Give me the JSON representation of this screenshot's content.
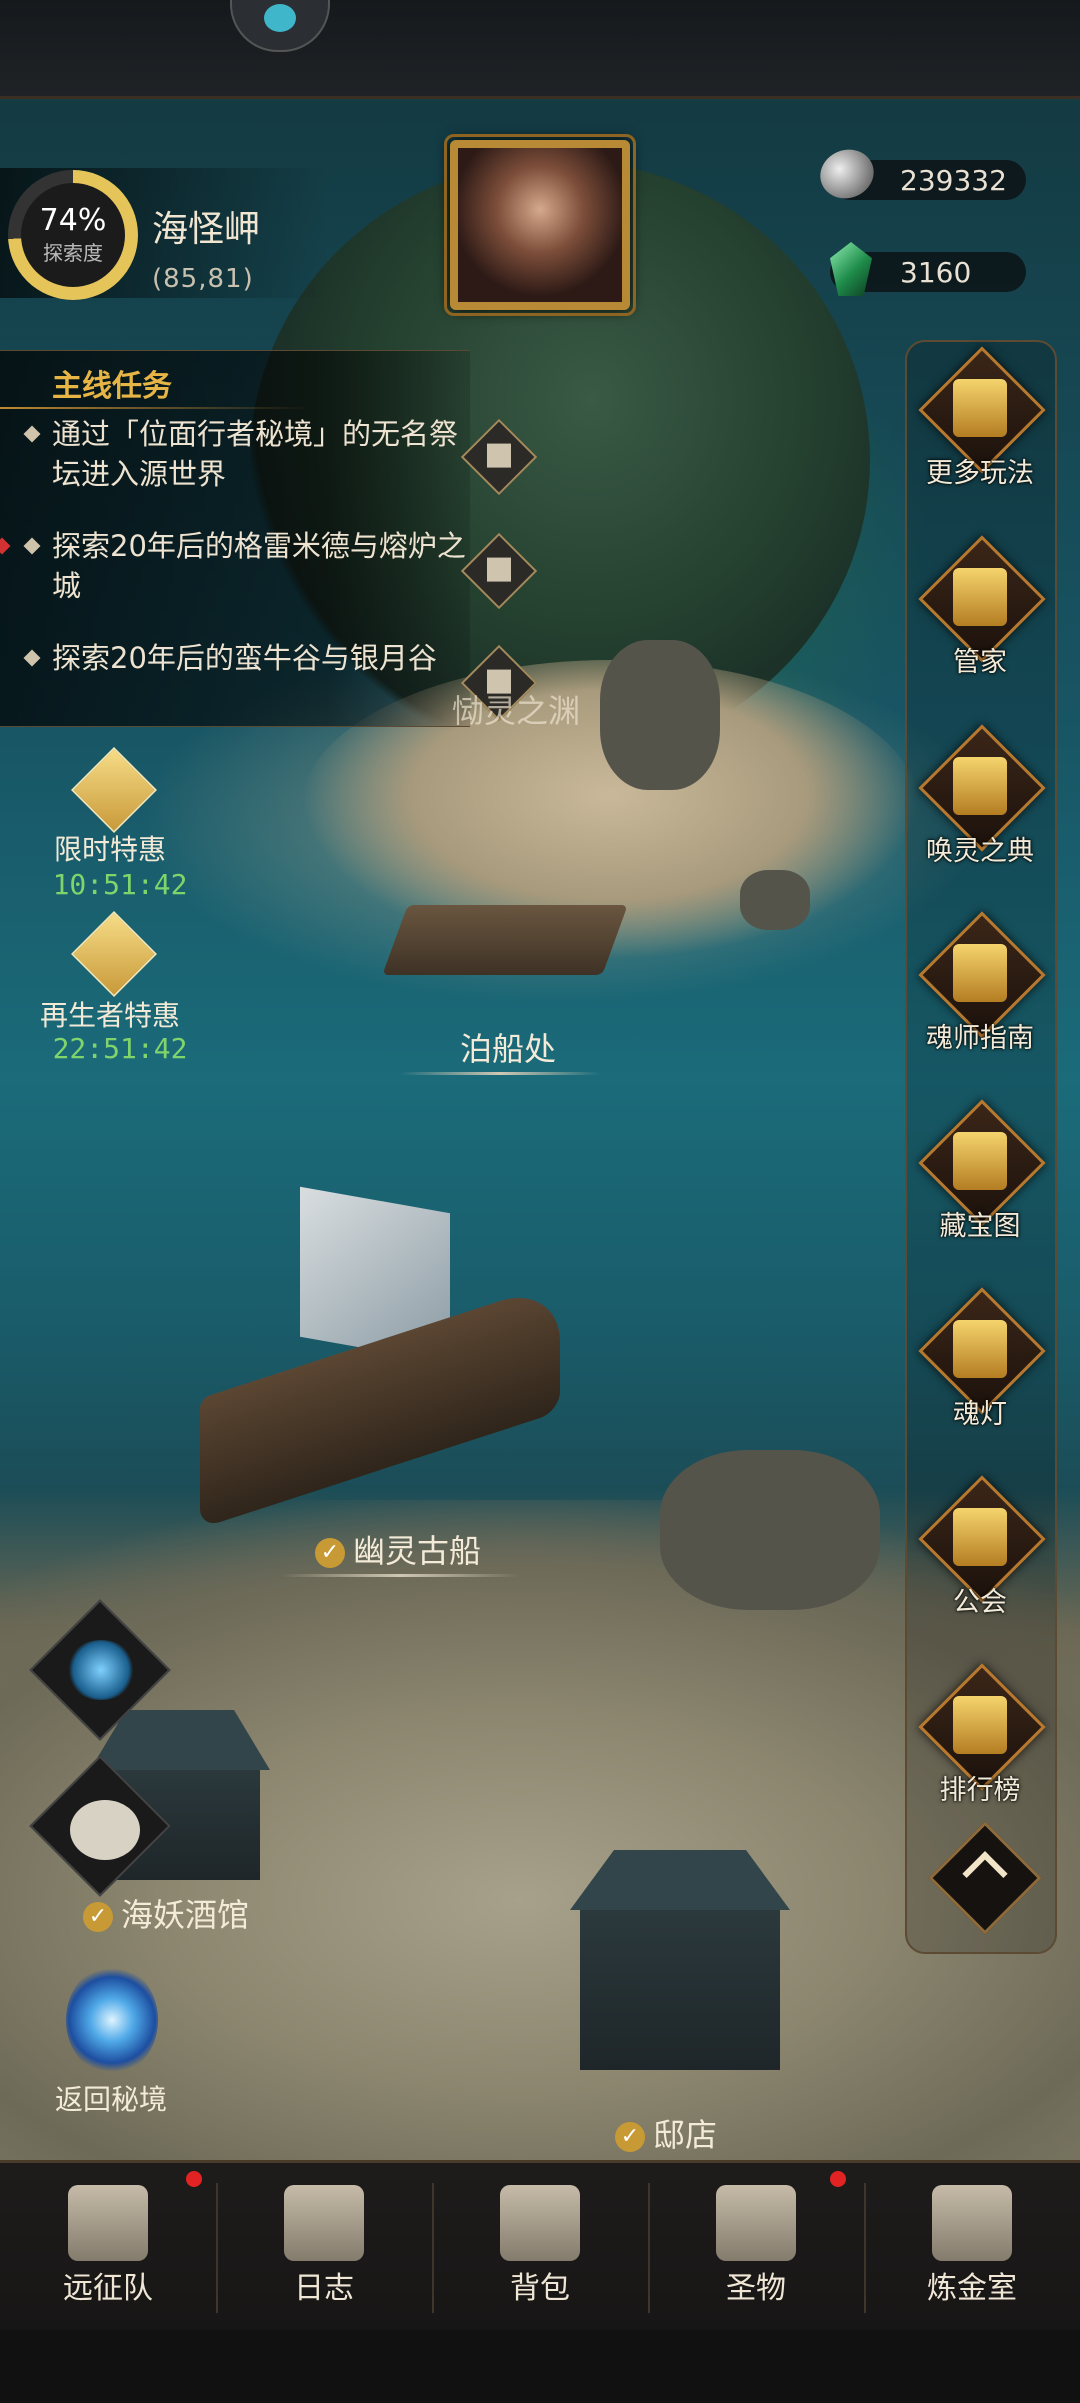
{
  "location": {
    "explore_pct": "74%",
    "explore_label": "探索度",
    "name": "海怪岬",
    "coords": "(85,81)"
  },
  "currencies": [
    {
      "icon": "silver-coin-icon",
      "value": "239332"
    },
    {
      "icon": "emerald-gem-icon",
      "value": "3160"
    }
  ],
  "quest": {
    "title": "主线任务",
    "items": [
      {
        "text": "通过「位面行者秘境」的无名祭坛进入源世界"
      },
      {
        "text": "探索20年后的格雷米德与熔炉之城"
      },
      {
        "text": "探索20年后的蛮牛谷与银月谷"
      }
    ]
  },
  "offers": [
    {
      "label": "限时特惠",
      "timer": "10:51:42"
    },
    {
      "label": "再生者特惠",
      "timer": "22:51:42"
    }
  ],
  "places": {
    "abyss": "恸灵之渊",
    "dock": "泊船处",
    "ghost_ship": "幽灵古船",
    "tavern": "海妖酒馆",
    "return_realm": "返回秘境",
    "shop": "邸店"
  },
  "side_menu": [
    {
      "label": "更多玩法",
      "icon": "gift-icon"
    },
    {
      "label": "管家",
      "icon": "scroll-quill-icon"
    },
    {
      "label": "唤灵之典",
      "icon": "book-icon"
    },
    {
      "label": "魂师指南",
      "icon": "banner-icon"
    },
    {
      "label": "藏宝图",
      "icon": "treasure-map-icon"
    },
    {
      "label": "魂灯",
      "icon": "lamp-icon"
    },
    {
      "label": "公会",
      "icon": "guild-emblem-icon"
    },
    {
      "label": "排行榜",
      "icon": "trophy-icon"
    }
  ],
  "bottom_nav": [
    {
      "label": "远征队",
      "icon": "viking-helmet-icon",
      "badge": true
    },
    {
      "label": "日志",
      "icon": "journal-icon",
      "badge": false
    },
    {
      "label": "背包",
      "icon": "backpack-icon",
      "badge": false
    },
    {
      "label": "圣物",
      "icon": "relic-icon",
      "badge": true
    },
    {
      "label": "炼金室",
      "icon": "alchemy-icon",
      "badge": false
    }
  ],
  "colors": {
    "accent_gold": "#e7b545",
    "timer_green": "#7fd46c",
    "badge_red": "#e12323"
  }
}
